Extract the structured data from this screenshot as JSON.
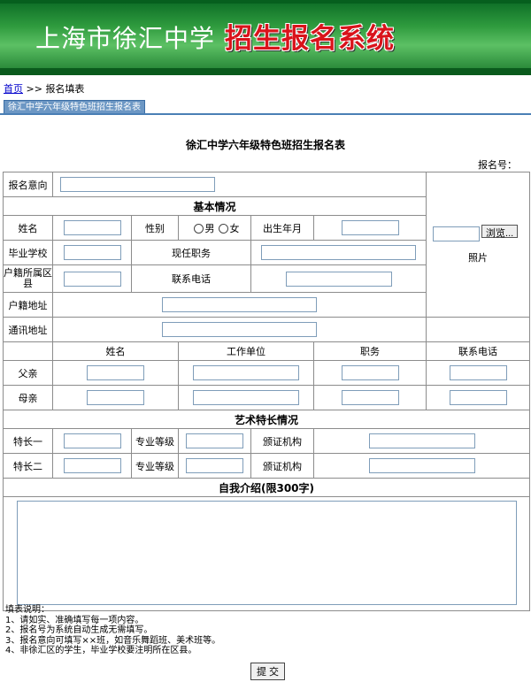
{
  "banner": {
    "school": "上海市徐汇中学",
    "system": "招生报名系统"
  },
  "breadcrumb": {
    "home": "首页",
    "sep": ">>",
    "current": "报名填表"
  },
  "tab": {
    "label": "徐汇中学六年级特色班招生报名表"
  },
  "form": {
    "title": "徐汇中学六年级特色班招生报名表",
    "reg_no_label": "报名号：",
    "intent_label": "报名意向",
    "basic_heading": "基本情况",
    "name_label": "姓名",
    "gender_label": "性别",
    "gender_male": "男",
    "gender_female": "女",
    "birth_label": "出生年月",
    "school_label": "毕业学校",
    "position_label": "现任职务",
    "district_label": "户籍所属区县",
    "phone_label": "联系电话",
    "address_label": "户籍地址",
    "mail_label": "通讯地址",
    "browse_label": "浏览...",
    "photo_label": "照片",
    "family_headers": [
      "姓名",
      "工作单位",
      "职务",
      "联系电话"
    ],
    "father_label": "父亲",
    "mother_label": "母亲",
    "art_heading": "艺术特长情况",
    "specialty1_label": "特长一",
    "specialty2_label": "特长二",
    "level_label": "专业等级",
    "cert_label": "颁证机构",
    "intro_heading": "自我介绍(限300字)"
  },
  "notes": {
    "title": "填表说明：",
    "items": [
      "1、请如实、准确填写每一项内容。",
      "2、报名号为系统自动生成无需填写。",
      "3、报名意向可填写××班，如音乐舞蹈班、美术班等。",
      "4、非徐汇区的学生，毕业学校要注明所在区县。"
    ]
  },
  "submit": {
    "label": "提 交"
  }
}
